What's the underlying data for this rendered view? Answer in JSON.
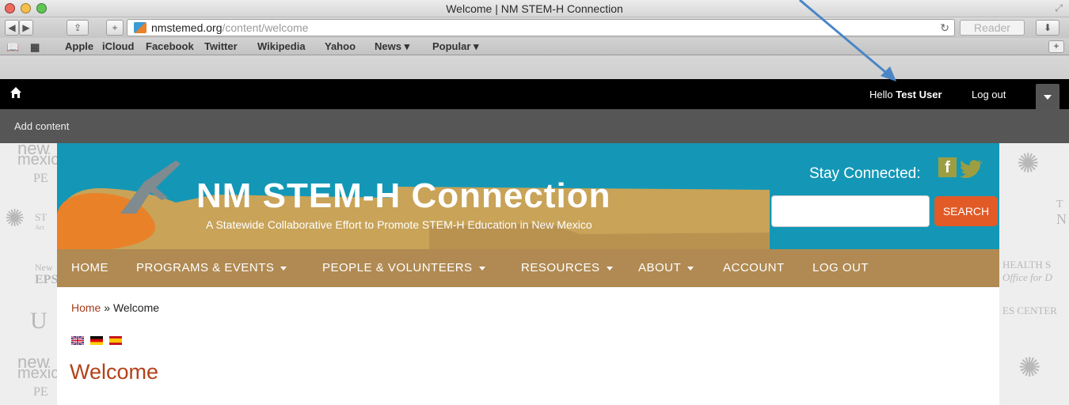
{
  "window": {
    "title": "Welcome | NM STEM-H Connection"
  },
  "address_bar": {
    "host": "nmstemed.org",
    "path": "/content/welcome",
    "reader_label": "Reader"
  },
  "bookmarks": [
    "Apple",
    "iCloud",
    "Facebook",
    "Twitter",
    "Wikipedia",
    "Yahoo",
    "News ▾",
    "Popular ▾"
  ],
  "admin": {
    "hello_prefix": "Hello ",
    "user": "Test User",
    "logout": "Log out",
    "add_content": "Add content"
  },
  "site": {
    "title": "NM STEM-H Connection",
    "slogan": "A Statewide Collaborative Effort to Promote STEM-H Education in New Mexico",
    "stay_connected": "Stay Connected:",
    "facebook_letter": "f",
    "search_button": "SEARCH"
  },
  "nav": [
    {
      "label": "HOME"
    },
    {
      "label": "PROGRAMS & EVENTS"
    },
    {
      "label": "PEOPLE & VOLUNTEERS"
    },
    {
      "label": "RESOURCES"
    },
    {
      "label": "ABOUT"
    },
    {
      "label": "ACCOUNT"
    },
    {
      "label": "LOG OUT"
    }
  ],
  "breadcrumb": {
    "home": "Home",
    "sep": " » ",
    "current": "Welcome"
  },
  "page": {
    "title": "Welcome"
  },
  "sponsors_left": [
    "new",
    "mexic",
    "PE",
    "ST",
    "Act",
    "New",
    "EPS",
    "U",
    "new",
    "mexic",
    "PE"
  ],
  "sponsors_right": [
    "T",
    "N",
    "HEALTH S",
    "Office for D",
    "ES CENTER"
  ],
  "colors": {
    "banner": "#1497b6",
    "nav": "#b08a52",
    "search_button": "#e25a25",
    "title": "#b3411a"
  }
}
